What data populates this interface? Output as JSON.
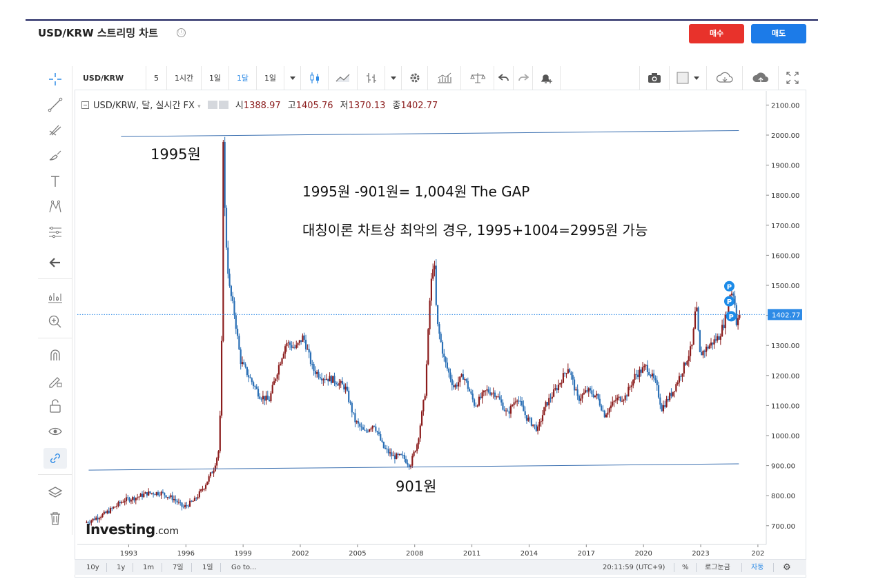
{
  "header": {
    "title": "USD/KRW 스트리밍 차트",
    "info_icon": "ⓘ",
    "buy_label": "매수",
    "sell_label": "매도"
  },
  "colors": {
    "up": "#8b1c1c",
    "down": "#2a6fb5",
    "buy": "#e8322b",
    "sell": "#1c7be8",
    "trend_line": "#3a6fb0",
    "current_price": "#2e8be6"
  },
  "left_toolbar": {
    "icons": [
      "crosshair-icon",
      "trend-line-icon",
      "fib-icon",
      "brush-icon",
      "text-icon",
      "pattern-icon",
      "measure-icon",
      "back-arrow-icon",
      "indicators-icon",
      "zoom-in-icon",
      "magnet-icon",
      "lock-drawing-icon",
      "unlock-icon",
      "eye-icon",
      "link-icon",
      "layers-icon",
      "trash-icon"
    ]
  },
  "top_toolbar": {
    "symbol": "USD/KRW",
    "items": [
      "5",
      "1시간",
      "1일",
      "1달",
      "1일"
    ],
    "active_item": "1달",
    "icons": [
      "candle-icon",
      "line-chart-icon",
      "bar-type-icon",
      "settings-icon",
      "indicator-icon",
      "compare-icon",
      "undo-icon",
      "redo-icon",
      "alert-icon",
      "camera-icon",
      "color-box-icon",
      "cloud-save-icon",
      "cloud-load-icon",
      "fullscreen-icon"
    ]
  },
  "legend": {
    "symbol_text": "USD/KRW, 달, 실시간 FX",
    "open_label": "시",
    "open": "1388.97",
    "high_label": "고",
    "high": "1405.76",
    "low_label": "저",
    "low": "1370.13",
    "close_label": "종",
    "close": "1402.77"
  },
  "annotations": {
    "peak_label": "1995원",
    "trough_label": "901원",
    "gap_text": "1995원 -901원= 1,004원 The GAP",
    "scenario_text": "대칭이론 차트상 최악의 경우, 1995+1004=2995원 가능"
  },
  "watermark": {
    "brand": "Investing",
    "suffix": ".com"
  },
  "bottom_bar": {
    "ranges": [
      "10y",
      "1y",
      "1m",
      "7일",
      "1일",
      "Go to..."
    ],
    "time": "20:11:59 (UTC+9)",
    "percent": "%",
    "log": "로그눈금",
    "auto": "자동"
  },
  "chart_data": {
    "type": "candlestick",
    "interval": "1 month",
    "symbol": "USD/KRW",
    "y_axis_ticks": [
      "2100.00",
      "2000.00",
      "1900.00",
      "1800.00",
      "1700.00",
      "1600.00",
      "1500.00",
      "1400.00",
      "1300.00",
      "1200.00",
      "1100.00",
      "1000.00",
      "900.00",
      "800.00",
      "700.00"
    ],
    "ylim": [
      650,
      2125
    ],
    "x_axis_ticks": [
      "1993",
      "1996",
      "1999",
      "2002",
      "2005",
      "2008",
      "2011",
      "2014",
      "2017",
      "2020",
      "2023",
      "202"
    ],
    "xlim": [
      1990.75,
      2025.0
    ],
    "current_price_label": "1402.77",
    "current_price": 1402.77,
    "upper_trendline": [
      [
        1992.6,
        1995
      ],
      [
        2025.0,
        2015
      ]
    ],
    "lower_trendline": [
      [
        1990.9,
        885
      ],
      [
        2025.0,
        906
      ]
    ],
    "markers": [
      {
        "label": "P",
        "x": 2024.5,
        "y": 1497
      },
      {
        "label": "P",
        "x": 2024.5,
        "y": 1447
      },
      {
        "label": "P",
        "x": 2024.6,
        "y": 1397
      }
    ],
    "path": [
      [
        1990.8,
        710
      ],
      [
        1991.8,
        740
      ],
      [
        1992.8,
        785
      ],
      [
        1993.5,
        795
      ],
      [
        1994.0,
        808
      ],
      [
        1994.7,
        810
      ],
      [
        1995.4,
        790
      ],
      [
        1995.9,
        760
      ],
      [
        1996.5,
        785
      ],
      [
        1997.0,
        830
      ],
      [
        1997.5,
        890
      ],
      [
        1997.8,
        960
      ],
      [
        1997.95,
        1400
      ],
      [
        1998.0,
        1995
      ],
      [
        1998.1,
        1700
      ],
      [
        1998.3,
        1500
      ],
      [
        1998.6,
        1400
      ],
      [
        1998.9,
        1250
      ],
      [
        1999.4,
        1190
      ],
      [
        1999.9,
        1135
      ],
      [
        2000.4,
        1115
      ],
      [
        2000.9,
        1230
      ],
      [
        2001.3,
        1310
      ],
      [
        2001.8,
        1290
      ],
      [
        2002.2,
        1330
      ],
      [
        2002.7,
        1220
      ],
      [
        2003.2,
        1195
      ],
      [
        2003.8,
        1185
      ],
      [
        2004.4,
        1160
      ],
      [
        2004.9,
        1050
      ],
      [
        2005.4,
        1010
      ],
      [
        2005.9,
        1040
      ],
      [
        2006.4,
        960
      ],
      [
        2006.9,
        930
      ],
      [
        2007.4,
        930
      ],
      [
        2007.8,
        901
      ],
      [
        2008.2,
        980
      ],
      [
        2008.6,
        1150
      ],
      [
        2008.85,
        1470
      ],
      [
        2009.05,
        1600
      ],
      [
        2009.2,
        1380
      ],
      [
        2009.6,
        1250
      ],
      [
        2010.1,
        1160
      ],
      [
        2010.6,
        1200
      ],
      [
        2011.2,
        1100
      ],
      [
        2011.8,
        1150
      ],
      [
        2012.3,
        1140
      ],
      [
        2012.9,
        1070
      ],
      [
        2013.4,
        1130
      ],
      [
        2013.9,
        1060
      ],
      [
        2014.5,
        1020
      ],
      [
        2014.9,
        1100
      ],
      [
        2015.6,
        1170
      ],
      [
        2016.1,
        1230
      ],
      [
        2016.6,
        1120
      ],
      [
        2017.1,
        1150
      ],
      [
        2017.6,
        1130
      ],
      [
        2018.0,
        1070
      ],
      [
        2018.6,
        1120
      ],
      [
        2019.1,
        1130
      ],
      [
        2019.6,
        1200
      ],
      [
        2020.2,
        1230
      ],
      [
        2020.7,
        1170
      ],
      [
        2021.0,
        1090
      ],
      [
        2021.6,
        1150
      ],
      [
        2022.1,
        1220
      ],
      [
        2022.6,
        1300
      ],
      [
        2022.8,
        1440
      ],
      [
        2023.0,
        1270
      ],
      [
        2023.5,
        1300
      ],
      [
        2024.0,
        1330
      ],
      [
        2024.3,
        1380
      ],
      [
        2024.6,
        1480
      ],
      [
        2024.8,
        1470
      ],
      [
        2024.9,
        1370
      ],
      [
        2025.0,
        1402.77
      ]
    ]
  }
}
